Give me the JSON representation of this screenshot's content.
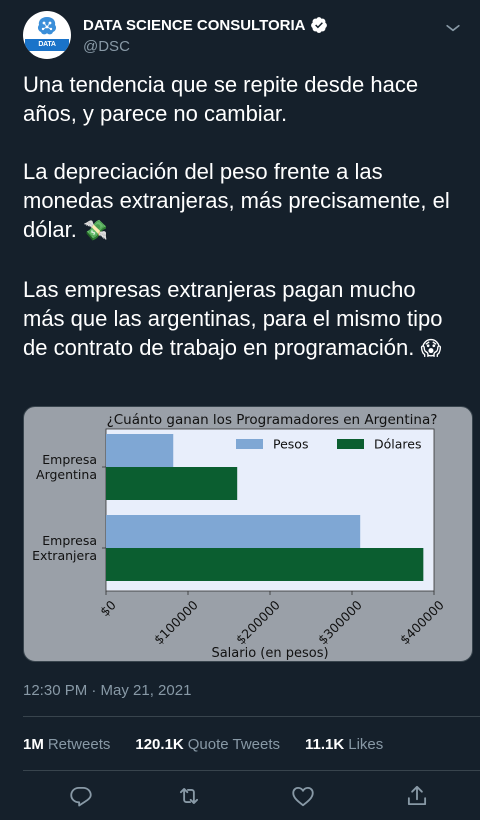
{
  "account": {
    "display_name": "DATA SCIENCE CONSULTORIA",
    "handle": "@DSC",
    "logo_text": "DATA SCIENCE"
  },
  "tweet": {
    "p1": "Una tendencia que se repite desde hace años, y parece no cambiar.",
    "p2": "La depreciación del peso frente a las monedas extranjeras, más precisamente, el dólar.",
    "p2_emoji": "💸",
    "p3": "Las empresas extranjeras pagan mucho más que las argentinas, para el mismo tipo de contrato de trabajo en programación.",
    "p3_emoji": "😱"
  },
  "timestamp": "12:30 PM · May 21, 2021",
  "stats": {
    "retweets_num": "1M",
    "retweets_label": "Retweets",
    "quotes_num": "120.1K",
    "quotes_label": "Quote Tweets",
    "likes_num": "11.1K",
    "likes_label": "Likes"
  },
  "icons": [
    "reply-icon",
    "retweet-icon",
    "like-icon",
    "share-icon",
    "more-icon",
    "verified-icon"
  ],
  "colors": {
    "background": "#15202b",
    "secondary_text": "#8899a6",
    "divider": "#38444d",
    "pesos": "#7fa7d4",
    "dolares": "#0b5e30",
    "plot_bg": "#e8eefb"
  },
  "chart_data": {
    "type": "bar",
    "orientation": "horizontal",
    "title": "¿Cuánto ganan los Programadores en Argentina?",
    "xlabel": "Salario (en pesos)",
    "ylabel": "",
    "categories": [
      "Empresa\nArgentina",
      "Empresa\nExtranjera"
    ],
    "series": [
      {
        "name": "Pesos",
        "values": [
          82000,
          310000
        ]
      },
      {
        "name": "Dólares",
        "values": [
          160000,
          387000
        ]
      }
    ],
    "xlim": [
      0,
      400000
    ],
    "xticks": [
      0,
      100000,
      200000,
      300000,
      400000
    ],
    "xtick_labels": [
      "$0",
      "$100000",
      "$200000",
      "$300000",
      "$400000"
    ],
    "legend": "top-right",
    "grid": false
  }
}
